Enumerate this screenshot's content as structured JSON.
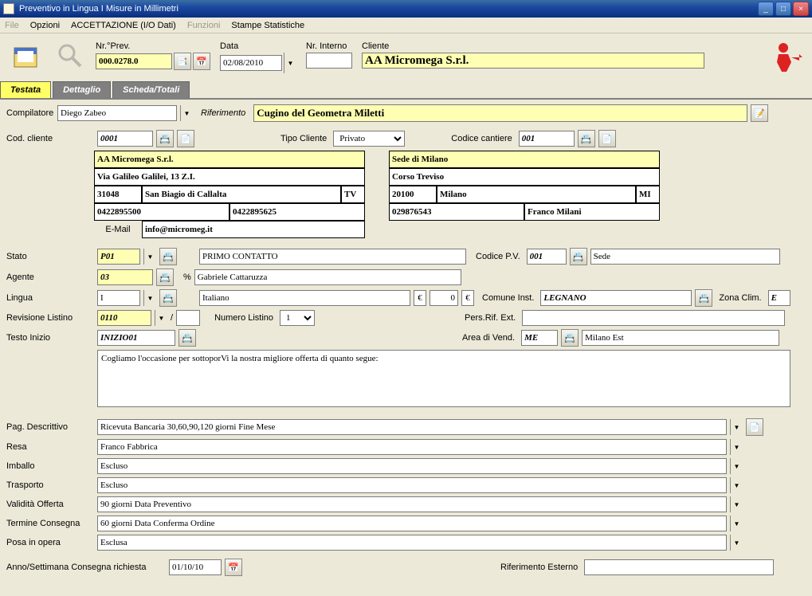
{
  "window": {
    "title": "Preventivo in Lingua I Misure in Millimetri"
  },
  "menu": {
    "file": "File",
    "opzioni": "Opzioni",
    "accettazione": "ACCETTAZIONE (I/O Dati)",
    "funzioni": "Funzioni",
    "stampe": "Stampe Statistiche"
  },
  "header": {
    "nr_prev_label": "Nr.°Prev.",
    "nr_prev": "000.0278.0",
    "data_label": "Data",
    "data": "02/08/2010",
    "nr_interno_label": "Nr. Interno",
    "nr_interno": "",
    "cliente_label": "Cliente",
    "cliente": "AA Micromega S.r.l."
  },
  "tabs": {
    "testata": "Testata",
    "dettaglio": "Dettaglio",
    "scheda": "Scheda/Totali"
  },
  "testata": {
    "compilatore_label": "Compilatore",
    "compilatore": "Diego Zabeo",
    "riferimento_label": "Riferimento",
    "riferimento": "Cugino del Geometra Miletti",
    "cod_cliente_label": "Cod. cliente",
    "cod_cliente": "0001",
    "tipo_cliente_label": "Tipo Cliente",
    "tipo_cliente": "Privato",
    "codice_cantiere_label": "Codice cantiere",
    "codice_cantiere": "001",
    "cliente_addr": {
      "nome": "AA Micromega S.r.l.",
      "via": "Via Galileo Galilei, 13 Z.I.",
      "cap": "31048",
      "citta": "San Biagio di Callalta",
      "prov": "TV",
      "tel1": "0422895500",
      "tel2": "0422895625",
      "email_label": "E-Mail",
      "email": "info@micromeg.it"
    },
    "cantiere_addr": {
      "nome": "Sede di Milano",
      "via": "Corso Treviso",
      "cap": "20100",
      "citta": "Milano",
      "prov": "MI",
      "tel": "029876543",
      "ref": "Franco Milani"
    },
    "stato_label": "Stato",
    "stato": "P01",
    "stato_desc": "PRIMO CONTATTO",
    "codice_pv_label": "Codice P.V.",
    "codice_pv": "001",
    "codice_pv_desc": "Sede",
    "agente_label": "Agente",
    "agente": "03",
    "agente_pct": "%",
    "agente_desc": "Gabriele Cattaruzza",
    "lingua_label": "Lingua",
    "lingua": "I",
    "lingua_desc": "Italiano",
    "lingua_eur1": "€",
    "lingua_val": "0",
    "lingua_eur2": "€",
    "comune_inst_label": "Comune Inst.",
    "comune_inst": "LEGNANO",
    "zona_clim_label": "Zona Clim.",
    "zona_clim": "E",
    "rev_listino_label": "Revisione Listino",
    "rev_listino": "0110",
    "rev_sep": "/",
    "numero_listino_label": "Numero Listino",
    "numero_listino": "1",
    "pers_rif_ext_label": "Pers.Rif. Ext.",
    "pers_rif_ext": "",
    "testo_inizio_label": "Testo Inizio",
    "testo_inizio": "INIZIO01",
    "area_vend_label": "Area di Vend.",
    "area_vend": "ME",
    "area_vend_desc": "Milano Est",
    "testo_body": "Cogliamo l'occasione per sottoporVi la nostra migliore offerta di quanto segue:",
    "pag_desc_label": "Pag. Descrittivo",
    "pag_desc": "Ricevuta Bancaria 30,60,90,120 giorni Fine Mese",
    "resa_label": "Resa",
    "resa": "Franco Fabbrica",
    "imballo_label": "Imballo",
    "imballo": "Escluso",
    "trasporto_label": "Trasporto",
    "trasporto": "Escluso",
    "validita_label": "Validità Offerta",
    "validita": "90 giorni Data Preventivo",
    "termine_label": "Termine Consegna",
    "termine": "60 giorni Data Conferma Ordine",
    "posa_label": "Posa in opera",
    "posa": "Esclusa",
    "anno_sett_label": "Anno/Settimana Consegna richiesta",
    "anno_sett": "01/10/10",
    "rif_esterno_label": "Riferimento Esterno",
    "rif_esterno": ""
  }
}
